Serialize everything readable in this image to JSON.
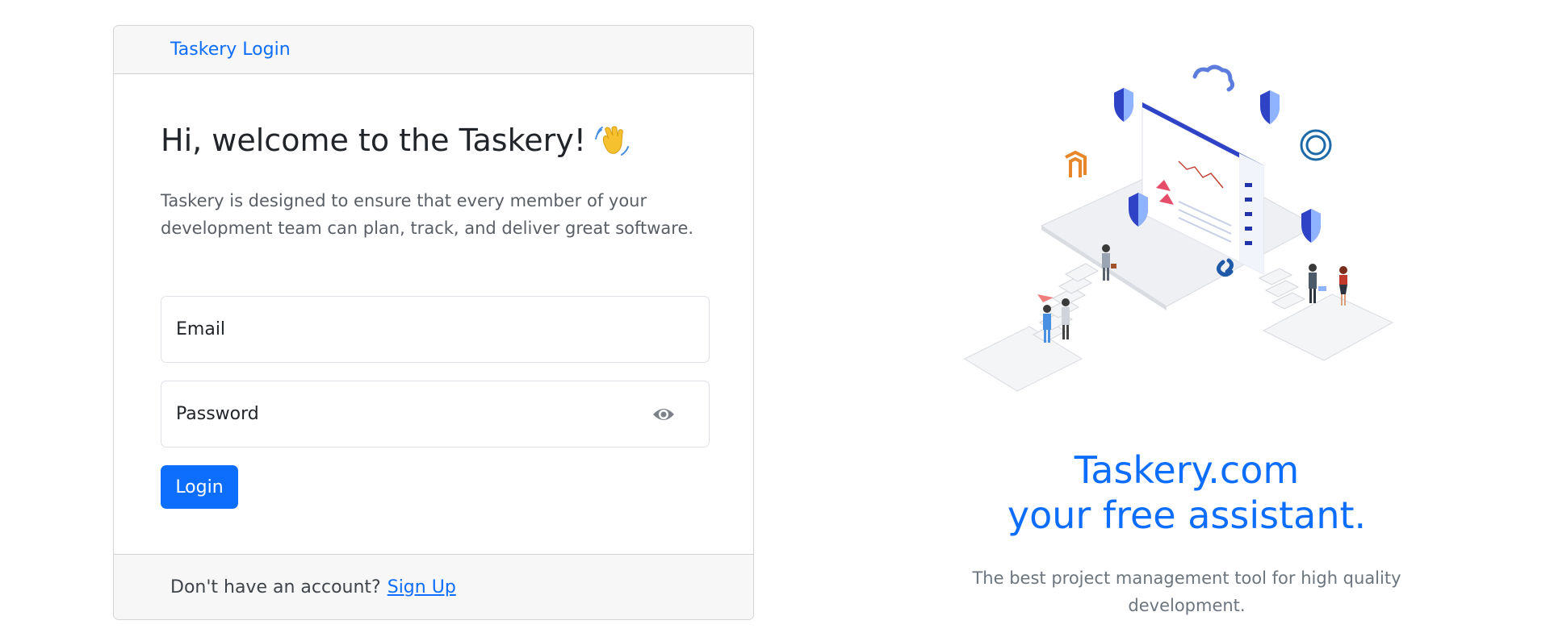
{
  "card": {
    "header_link": "Taskery Login",
    "welcome_title": "Hi, welcome to the Taskery!",
    "welcome_emoji": "waving-hand-icon",
    "intro_text": "Taskery is designed to ensure that every member of your development team can plan, track, and deliver great software.",
    "email_placeholder": "Email",
    "password_placeholder": "Password",
    "password_toggle_icon": "eye-icon",
    "login_button": "Login",
    "footer_text": "Don't have an account?",
    "footer_link": "Sign Up"
  },
  "promo": {
    "tagline_line1": "Taskery.com",
    "tagline_line2": "your free assistant.",
    "subtext": "The best project management tool for high quality development."
  },
  "colors": {
    "primary": "#0d6efd",
    "muted": "#6c757d",
    "header_bg": "#f7f7f7"
  }
}
